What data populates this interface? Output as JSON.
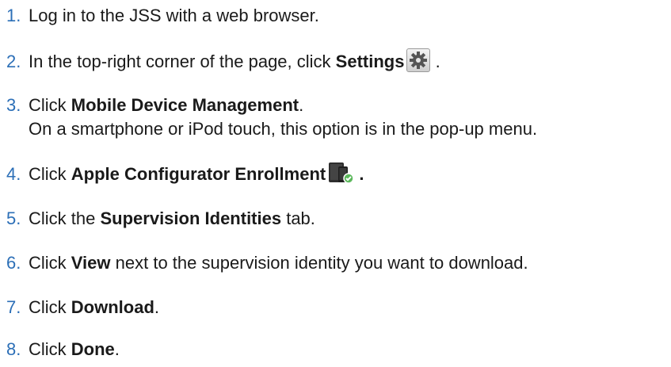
{
  "steps": [
    {
      "num": "1.",
      "text": "Log in to the JSS with a web browser."
    },
    {
      "num": "2.",
      "pre": "In the top-right corner of the page, click ",
      "bold": "Settings",
      "post": " ."
    },
    {
      "num": "3.",
      "pre": "Click ",
      "bold": "Mobile Device Management",
      "post": ".",
      "sub": "On a smartphone or iPod touch, this option is in the pop-up menu."
    },
    {
      "num": "4.",
      "pre": "Click ",
      "bold": "Apple Configurator Enrollment",
      "post": " ."
    },
    {
      "num": "5.",
      "pre": "Click the ",
      "bold": "Supervision Identities",
      "post": " tab."
    },
    {
      "num": "6.",
      "pre": "Click ",
      "bold": "View",
      "post": " next to the supervision identity you want to download."
    },
    {
      "num": "7.",
      "pre": "Click ",
      "bold": "Download",
      "post": "."
    },
    {
      "num": "8.",
      "pre": "Click ",
      "bold": "Done",
      "post": "."
    }
  ],
  "icons": {
    "settings": "gear-icon",
    "enrollment": "apple-configurator-enrollment-icon"
  },
  "colors": {
    "number": "#2c6fb7",
    "text": "#1a1a1a",
    "badge": "#5cb85c"
  }
}
